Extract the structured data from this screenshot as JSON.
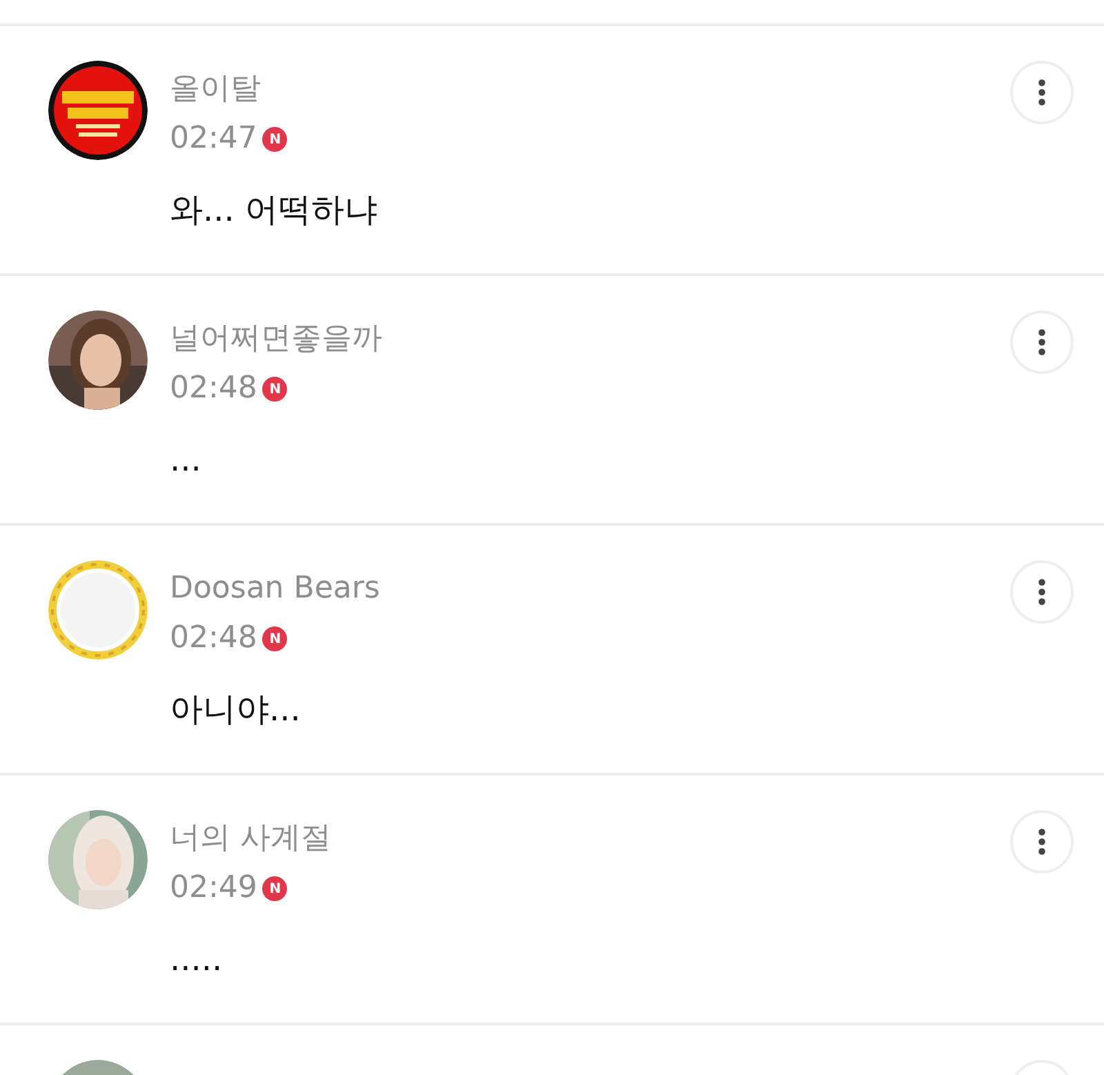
{
  "comments": [
    {
      "avatar": {
        "kind": "picture"
      },
      "author": "올이탈",
      "time": "02:47",
      "badge": "N",
      "text": "와... 어떡하냐"
    },
    {
      "avatar": {
        "kind": "picture"
      },
      "author": "널어쩌면좋을까",
      "time": "02:48",
      "badge": "N",
      "text": "..."
    },
    {
      "avatar": {
        "kind": "picture"
      },
      "author": "Doosan Bears",
      "time": "02:48",
      "badge": "N",
      "text": "아니야..."
    },
    {
      "avatar": {
        "kind": "picture"
      },
      "author": "너의 사계절",
      "time": "02:49",
      "badge": "N",
      "text": "....."
    },
    {
      "avatar": {
        "kind": "picture"
      }
    }
  ]
}
